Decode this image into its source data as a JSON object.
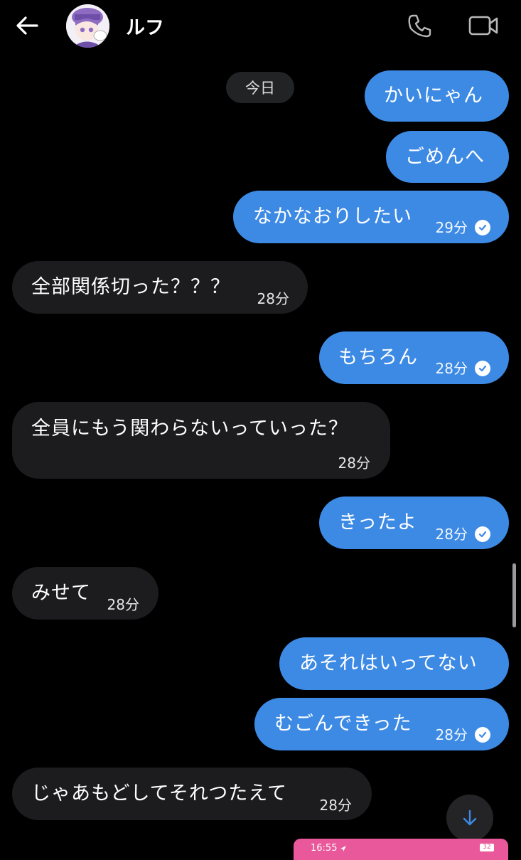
{
  "header": {
    "contact_name": "ルフ"
  },
  "date_chip": "今日",
  "messages": [
    {
      "dir": "out",
      "text": "かいにゃん"
    },
    {
      "dir": "out",
      "text": "ごめんへ"
    },
    {
      "dir": "out",
      "text": "なかなおりしたい",
      "time": "29分",
      "seen": true
    },
    {
      "dir": "in",
      "text": "全部関係切った？？？",
      "time": "28分"
    },
    {
      "dir": "out",
      "text": "もちろん",
      "time": "28分",
      "seen": true
    },
    {
      "dir": "in",
      "text": "全員にもう関わらないっていった？",
      "time": "28分"
    },
    {
      "dir": "out",
      "text": "きったよ",
      "time": "28分",
      "seen": true
    },
    {
      "dir": "in",
      "text": "みせて",
      "time": "28分"
    },
    {
      "dir": "out",
      "text": "あそれはいってない"
    },
    {
      "dir": "out",
      "text": "むごんできった",
      "time": "28分",
      "seen": true
    },
    {
      "dir": "in",
      "text": "じゃあもどしてそれつたえて",
      "time": "28分"
    }
  ],
  "status_strip": {
    "time": "16:55",
    "battery": "32"
  },
  "colors": {
    "outgoing_bubble": "#3d8ae5",
    "incoming_bubble": "#1c1c1e",
    "background": "#000000",
    "status_strip": "#e8589a"
  },
  "icons": {
    "back": "arrow-left-icon",
    "call": "phone-icon",
    "video": "video-camera-icon",
    "seen": "check-circle-icon",
    "scroll_down": "arrow-down-icon"
  }
}
